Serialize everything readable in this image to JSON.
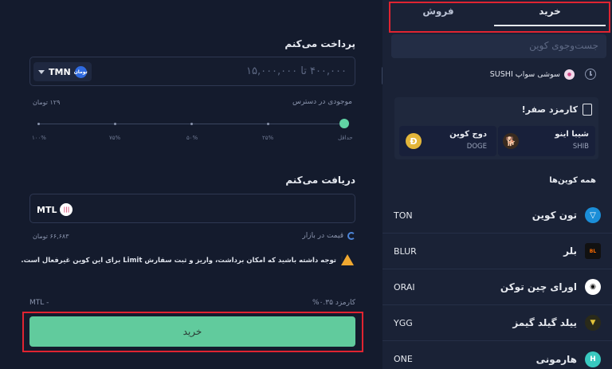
{
  "pay": {
    "title": "پرداخت می‌کنم",
    "placeholder": "۴۰۰,۰۰۰ تا ۱۵,۰۰۰,۰۰۰",
    "currency": "TMN",
    "currency_badge": "تومان",
    "available_label": "موجودی در دسترس",
    "available_value": "۱۲۹ تومان",
    "slider_labels": [
      "حداقل",
      "۲۵%",
      "۵۰%",
      "۷۵%",
      "۱۰۰%"
    ],
    "slider_value_percent": 0
  },
  "receive": {
    "title": "دریافت می‌کنم",
    "currency": "MTL",
    "market_price_label": "قیمت در بازار",
    "market_price_value": "۶۶,۶۸۳ تومان"
  },
  "warning": {
    "text": "توجه داشته باشید که امکان برداشت، واریز و ثبت سفارش Limit برای این کوین غیرفعال است."
  },
  "fee": {
    "label": "کارمزد ۰.۳۵%",
    "value": "- MTL"
  },
  "buy_button": {
    "label": "خرید"
  },
  "tabs": {
    "buy": "خرید",
    "sell": "فروش"
  },
  "search": {
    "placeholder": "جست‌وجوی کوین"
  },
  "recent": {
    "label": "سوشی سواپ SUSHI"
  },
  "zero_fee": {
    "title": "کارمزد صفر!",
    "coins": [
      {
        "name": "شیبا اینو",
        "symbol": "SHIB",
        "icon": "shiba-icon",
        "color": "#f07a1a"
      },
      {
        "name": "دوج کوین",
        "symbol": "DOGE",
        "icon": "doge-icon",
        "color": "#e3b63a"
      }
    ]
  },
  "all_coins": {
    "title": "همه کوین‌ها",
    "items": [
      {
        "name": "تون کوین",
        "symbol": "TON",
        "icon": "ton-icon",
        "color": "#1b8ed8"
      },
      {
        "name": "بلر",
        "symbol": "BLUR",
        "icon": "blur-icon",
        "color": "#ff6b00"
      },
      {
        "name": "اورای چین توکن",
        "symbol": "ORAI",
        "icon": "orai-icon",
        "color": "#ffffff"
      },
      {
        "name": "ییلد گیلد گیمز",
        "symbol": "YGG",
        "icon": "ygg-icon",
        "color": "#e3c33a"
      },
      {
        "name": "هارمونی",
        "symbol": "ONE",
        "icon": "harmony-icon",
        "color": "#39c9c0"
      }
    ]
  }
}
